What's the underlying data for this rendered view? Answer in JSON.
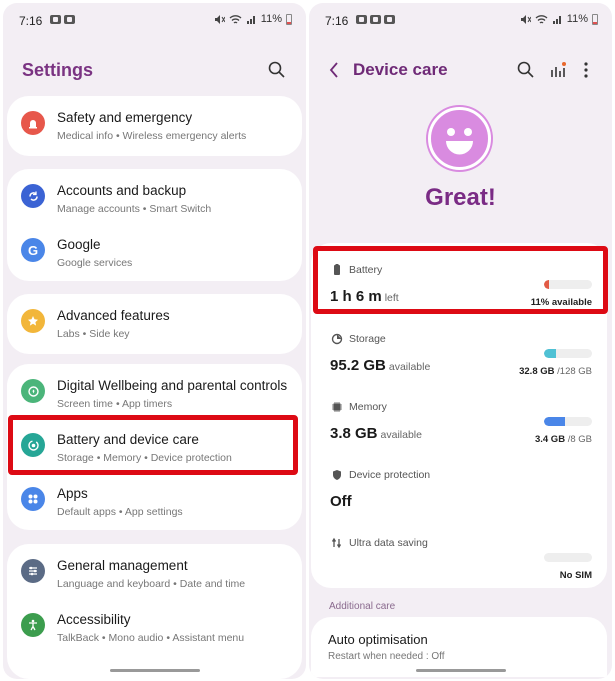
{
  "left": {
    "status": {
      "time": "7:16",
      "battery": "11%"
    },
    "title": "Settings",
    "cards": [
      [
        {
          "title": "Safety and emergency",
          "sub": "Medical info  •  Wireless emergency alerts",
          "icon": "siren-icon",
          "color": "#e7574b"
        }
      ],
      [
        {
          "title": "Accounts and backup",
          "sub": "Manage accounts  •  Smart Switch",
          "icon": "sync-icon",
          "color": "#3b63d4"
        },
        {
          "title": "Google",
          "sub": "Google services",
          "icon": "google-icon",
          "color": "#4a86e8"
        }
      ],
      [
        {
          "title": "Advanced features",
          "sub": "Labs  •  Side key",
          "icon": "star-icon",
          "color": "#f2b63a"
        }
      ],
      [
        {
          "title": "Digital Wellbeing and parental controls",
          "sub": "Screen time  •  App timers",
          "icon": "wellbeing-icon",
          "color": "#4bb57a"
        },
        {
          "title": "Battery and device care",
          "sub": "Storage  •  Memory  •  Device protection",
          "icon": "device-care-icon",
          "color": "#26a696"
        },
        {
          "title": "Apps",
          "sub": "Default apps  •  App settings",
          "icon": "apps-icon",
          "color": "#4a86e8"
        }
      ],
      [
        {
          "title": "General management",
          "sub": "Language and keyboard  •  Date and time",
          "icon": "sliders-icon",
          "color": "#5b6b85"
        },
        {
          "title": "Accessibility",
          "sub": "TalkBack  •  Mono audio  •  Assistant menu",
          "icon": "accessibility-icon",
          "color": "#3c9d4e"
        }
      ]
    ]
  },
  "right": {
    "status": {
      "time": "7:16",
      "battery": "11%"
    },
    "title": "Device care",
    "status_text": "Great!",
    "battery": {
      "label": "Battery",
      "value": "1 h 6 m",
      "unit": "left",
      "right": "11% available",
      "level": 0.11,
      "color": "#e25b45"
    },
    "storage": {
      "label": "Storage",
      "value": "95.2 GB",
      "unit": "available",
      "used": "32.8 GB",
      "total": "/128 GB",
      "level": 0.26,
      "color": "#4fc1d4"
    },
    "memory": {
      "label": "Memory",
      "value": "3.8 GB",
      "unit": "available",
      "used": "3.4 GB",
      "total": "/8 GB",
      "level": 0.43,
      "color": "#4a86e8"
    },
    "protection": {
      "label": "Device protection",
      "value": "Off"
    },
    "ultra": {
      "label": "Ultra data saving",
      "right": "No SIM"
    },
    "section": "Additional care",
    "auto": {
      "title": "Auto optimisation",
      "sub": "Restart when needed : Off"
    }
  }
}
